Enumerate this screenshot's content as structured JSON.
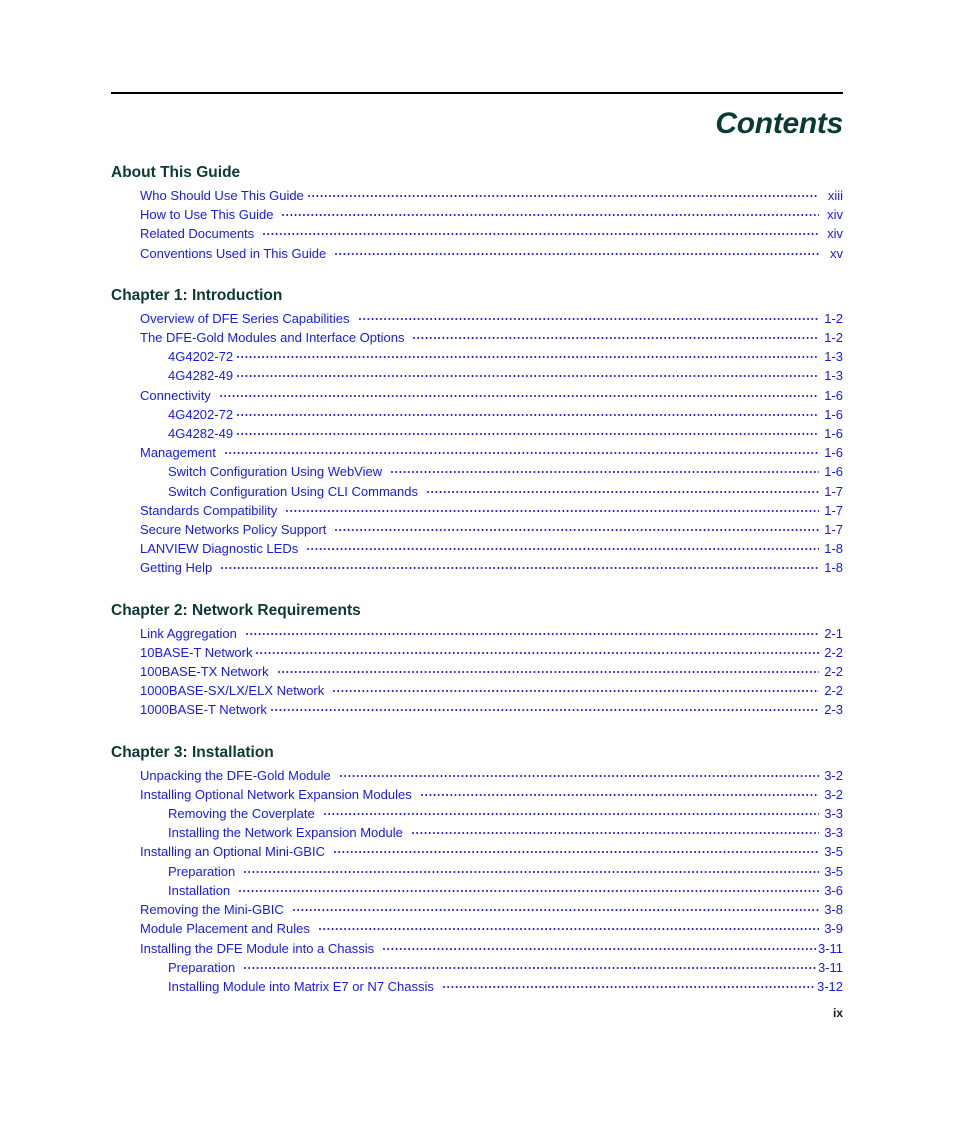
{
  "document": {
    "page_title": "Contents",
    "folio": "ix"
  },
  "sections": [
    {
      "heading": "About This Guide",
      "entries": [
        {
          "label": "Who Should Use This Guide",
          "page": "xiii",
          "level": 1,
          "gap": "narrow"
        },
        {
          "label": "How to Use This Guide",
          "page": "xiv",
          "level": 1,
          "gap": "wide"
        },
        {
          "label": "Related Documents",
          "page": "xiv",
          "level": 1,
          "gap": "wide"
        },
        {
          "label": "Conventions Used in This Guide",
          "page": "xv",
          "level": 1,
          "gap": "wide"
        }
      ]
    },
    {
      "heading": "Chapter 1: Introduction",
      "entries": [
        {
          "label": "Overview of DFE Series Capabilities",
          "page": "1-2",
          "level": 1,
          "gap": "wide"
        },
        {
          "label": "The DFE-Gold Modules and Interface Options",
          "page": "1-2",
          "level": 1,
          "gap": "wide"
        },
        {
          "label": "4G4202-72",
          "page": "1-3",
          "level": 2,
          "gap": "narrow"
        },
        {
          "label": "4G4282-49",
          "page": "1-3",
          "level": 2,
          "gap": "narrow"
        },
        {
          "label": "Connectivity",
          "page": "1-6",
          "level": 1,
          "gap": "wide"
        },
        {
          "label": "4G4202-72",
          "page": "1-6",
          "level": 2,
          "gap": "narrow"
        },
        {
          "label": "4G4282-49",
          "page": "1-6",
          "level": 2,
          "gap": "narrow"
        },
        {
          "label": "Management",
          "page": "1-6",
          "level": 1,
          "gap": "wide"
        },
        {
          "label": "Switch Configuration Using WebView",
          "page": "1-6",
          "level": 2,
          "gap": "wide"
        },
        {
          "label": "Switch Configuration Using CLI Commands",
          "page": "1-7",
          "level": 2,
          "gap": "wide"
        },
        {
          "label": "Standards Compatibility",
          "page": "1-7",
          "level": 1,
          "gap": "wide"
        },
        {
          "label": "Secure Networks Policy Support",
          "page": "1-7",
          "level": 1,
          "gap": "wide"
        },
        {
          "label": "LANVIEW Diagnostic LEDs",
          "page": "1-8",
          "level": 1,
          "gap": "wide"
        },
        {
          "label": "Getting Help",
          "page": "1-8",
          "level": 1,
          "gap": "wide"
        }
      ]
    },
    {
      "heading": "Chapter 2: Network Requirements",
      "entries": [
        {
          "label": "Link Aggregation",
          "page": "2-1",
          "level": 1,
          "gap": "wide"
        },
        {
          "label": "10BASE-T Network",
          "page": "2-2",
          "level": 1,
          "gap": "narrow"
        },
        {
          "label": "100BASE-TX Network",
          "page": "2-2",
          "level": 1,
          "gap": "wide"
        },
        {
          "label": "1000BASE-SX/LX/ELX Network",
          "page": "2-2",
          "level": 1,
          "gap": "wide"
        },
        {
          "label": "1000BASE-T Network",
          "page": "2-3",
          "level": 1,
          "gap": "narrow"
        }
      ]
    },
    {
      "heading": "Chapter 3: Installation",
      "entries": [
        {
          "label": "Unpacking the DFE-Gold Module",
          "page": "3-2",
          "level": 1,
          "gap": "wide"
        },
        {
          "label": "Installing Optional Network Expansion Modules",
          "page": "3-2",
          "level": 1,
          "gap": "wide"
        },
        {
          "label": "Removing the Coverplate",
          "page": "3-3",
          "level": 2,
          "gap": "wide"
        },
        {
          "label": "Installing the Network Expansion Module",
          "page": "3-3",
          "level": 2,
          "gap": "wide"
        },
        {
          "label": "Installing an Optional Mini-GBIC",
          "page": "3-5",
          "level": 1,
          "gap": "wide"
        },
        {
          "label": "Preparation",
          "page": "3-5",
          "level": 2,
          "gap": "wide"
        },
        {
          "label": "Installation",
          "page": "3-6",
          "level": 2,
          "gap": "wide"
        },
        {
          "label": "Removing the Mini-GBIC",
          "page": "3-8",
          "level": 1,
          "gap": "wide"
        },
        {
          "label": "Module Placement and Rules",
          "page": "3-9",
          "level": 1,
          "gap": "wide"
        },
        {
          "label": "Installing the DFE Module into a Chassis",
          "page": "3-11",
          "level": 1,
          "gap": "wide"
        },
        {
          "label": "Preparation",
          "page": "3-11",
          "level": 2,
          "gap": "wide"
        },
        {
          "label": "Installing Module into Matrix E7 or N7 Chassis",
          "page": "3-12",
          "level": 2,
          "gap": "wide"
        }
      ]
    }
  ]
}
